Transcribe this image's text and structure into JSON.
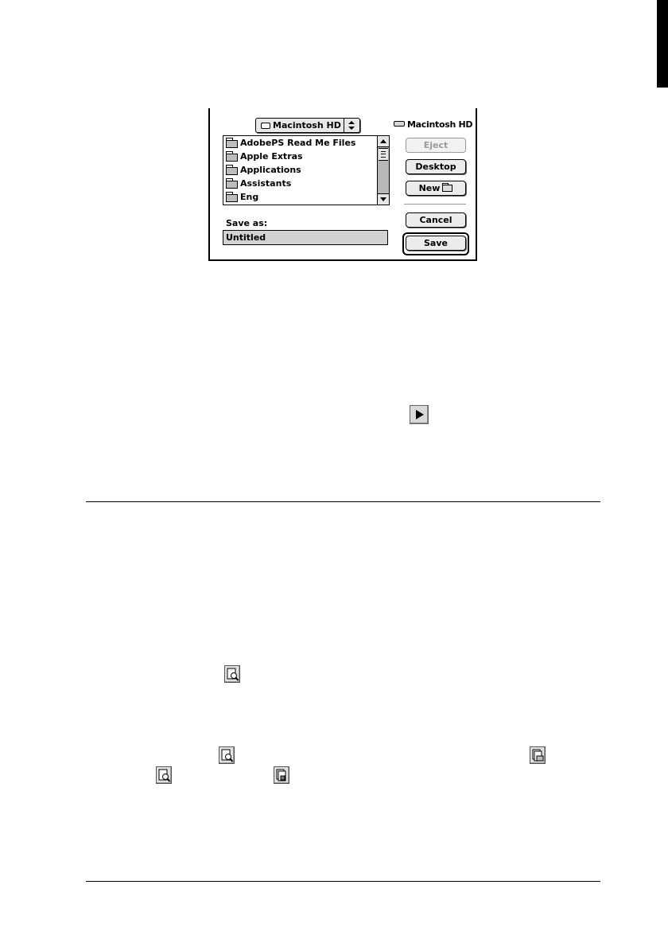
{
  "dialog": {
    "location_popup": "Macintosh HD",
    "volume_name": "Macintosh HD",
    "files": [
      "AdobePS Read Me Files",
      "Apple Extras",
      "Applications",
      "Assistants",
      "Eng"
    ],
    "buttons": {
      "eject": "Eject",
      "desktop": "Desktop",
      "new": "New",
      "cancel": "Cancel",
      "save": "Save"
    },
    "save_as_label": "Save as:",
    "save_as_value": "Untitled"
  },
  "icons": {
    "play": "play-triangle-icon",
    "preview": "preview-magnifier-icon",
    "print": "print-icon",
    "save": "save-file-icon"
  }
}
